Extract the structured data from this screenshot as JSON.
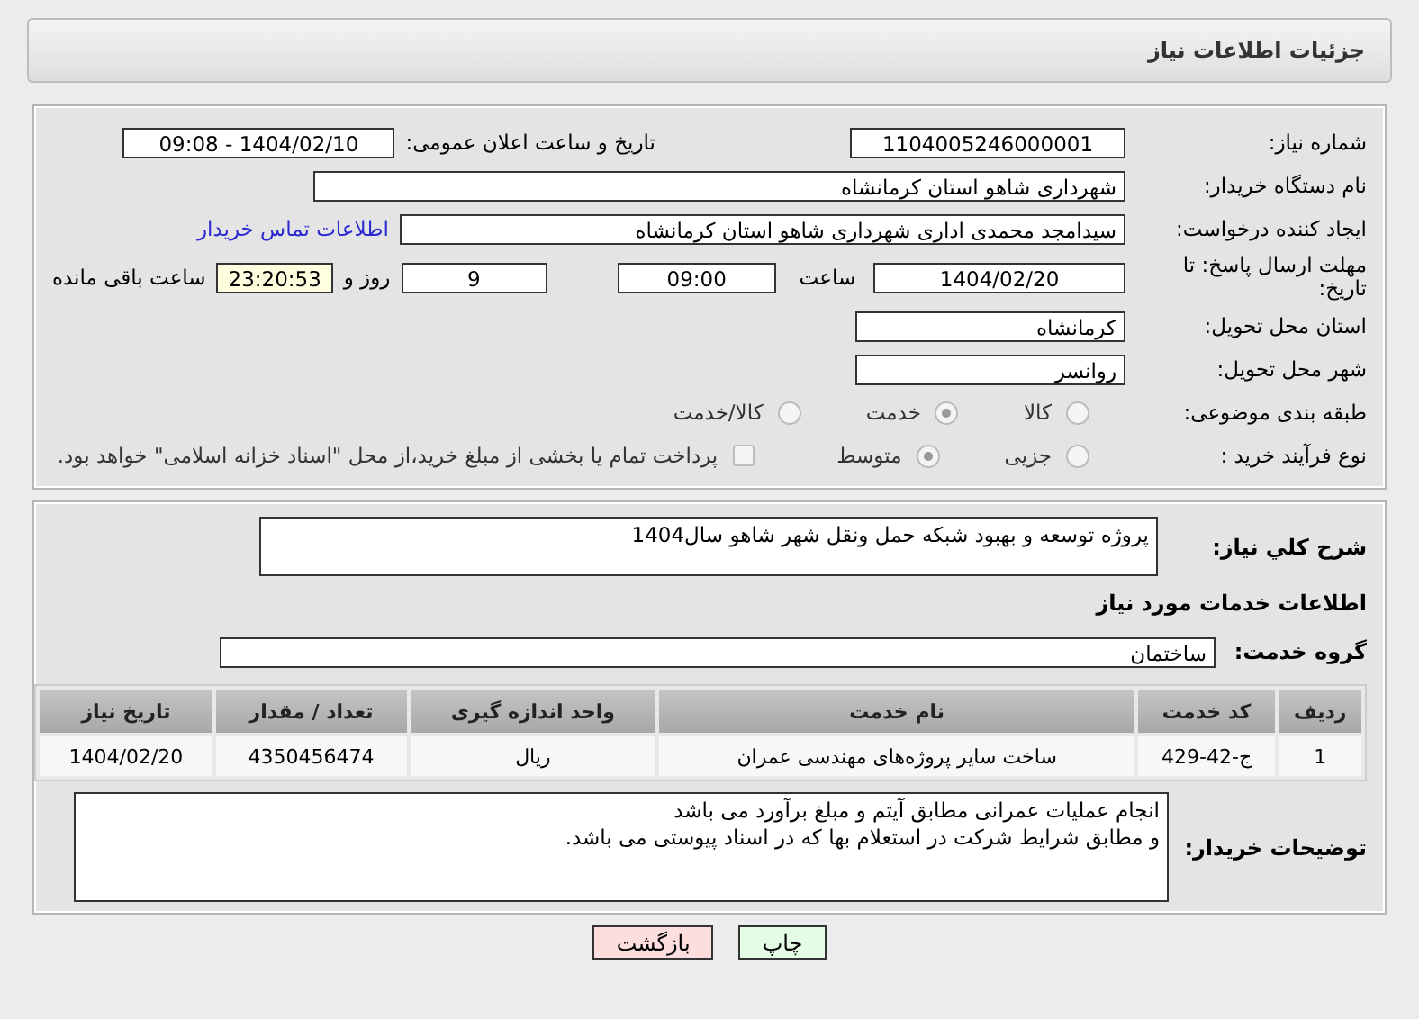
{
  "header": {
    "title": "جزئیات اطلاعات نیاز"
  },
  "need_number": {
    "label": "شماره نیاز:",
    "value": "1104005246000001"
  },
  "announce": {
    "label": "تاریخ و ساعت اعلان عمومی:",
    "value": "1404/02/10 - 09:08"
  },
  "buyer_org": {
    "label": "نام دستگاه خریدار:",
    "value": "شهرداری شاهو استان کرمانشاه"
  },
  "requester": {
    "label": "ایجاد کننده درخواست:",
    "value": "سیدامجد محمدی اداری شهرداری شاهو استان کرمانشاه",
    "link": "اطلاعات تماس خریدار"
  },
  "deadline": {
    "label": "مهلت ارسال پاسخ: تا تاریخ:",
    "date": "1404/02/20",
    "time_label": "ساعت",
    "time": "09:00",
    "days": "9",
    "days_label": "روز و",
    "remaining": "23:20:53",
    "remaining_label": "ساعت باقی مانده"
  },
  "province": {
    "label": "استان محل تحویل:",
    "value": "کرمانشاه"
  },
  "city": {
    "label": "شهر محل تحویل:",
    "value": "روانسر"
  },
  "category": {
    "label": "طبقه بندی موضوعی:",
    "options": [
      {
        "label": "کالا",
        "selected": false
      },
      {
        "label": "خدمت",
        "selected": true
      },
      {
        "label": "کالا/خدمت",
        "selected": false
      }
    ]
  },
  "process": {
    "label": "نوع فرآیند خرید :",
    "options": [
      {
        "label": "جزیی",
        "selected": false
      },
      {
        "label": "متوسط",
        "selected": true
      }
    ],
    "payment": {
      "label": "پرداخت تمام یا بخشی از مبلغ خرید،از محل \"اسناد خزانه اسلامی\" خواهد بود.",
      "checked": false
    }
  },
  "summary": {
    "label": "شرح کلي نیاز:",
    "value": "پروژه توسعه و بهبود شبکه حمل ونقل شهر شاهو سال1404"
  },
  "services_title": "اطلاعات خدمات مورد نیاز",
  "service_group": {
    "label": "گروه خدمت:",
    "value": "ساختمان"
  },
  "table": {
    "columns": [
      "ردیف",
      "کد خدمت",
      "نام خدمت",
      "واحد اندازه گیری",
      "تعداد / مقدار",
      "تاریخ نیاز"
    ],
    "rows": [
      [
        "1",
        "ج-42-429",
        "ساخت سایر پروژه‌های مهندسی عمران",
        "ریال",
        "4350456474",
        "1404/02/20"
      ]
    ]
  },
  "buyer_notes": {
    "label": "توضیحات خریدار:",
    "value": "انجام عملیات عمرانی مطابق آیتم و مبلغ برآورد می باشد\nو مطابق شرایط شرکت در استعلام بها که در اسناد پیوستی می باشد."
  },
  "buttons": [
    {
      "label": "چاپ",
      "kind": "print"
    },
    {
      "label": "بازگشت",
      "kind": "back"
    }
  ]
}
